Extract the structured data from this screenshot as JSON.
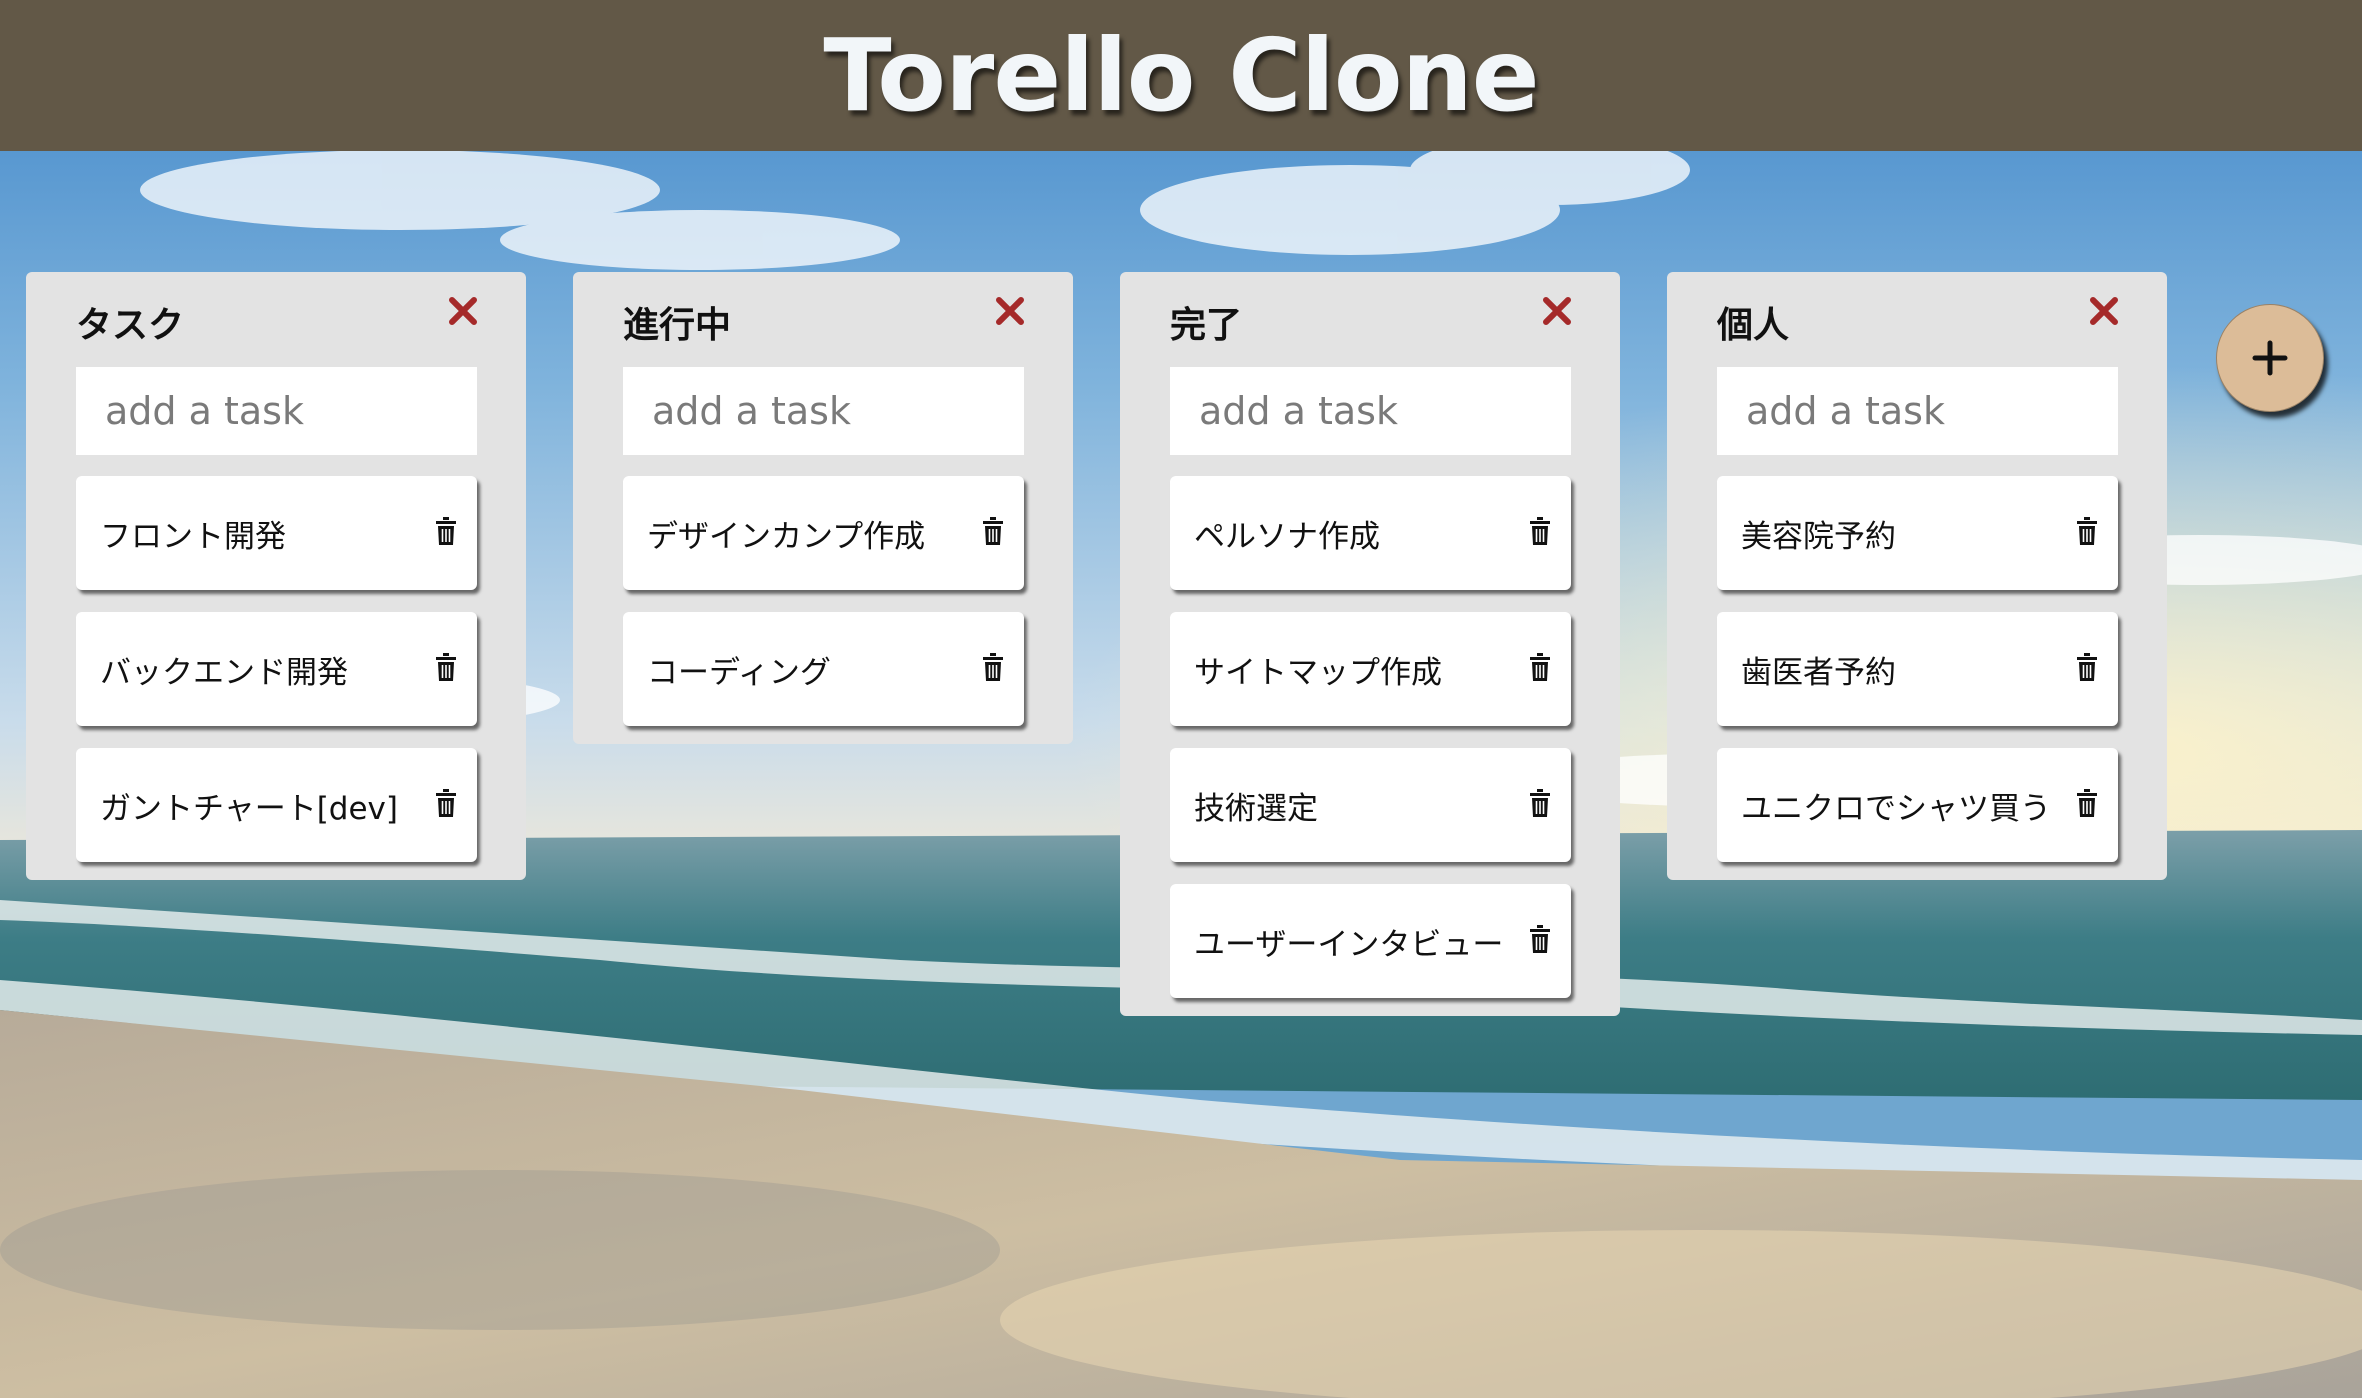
{
  "header": {
    "title": "Torello Clone"
  },
  "add_placeholder": "add a task",
  "add_list_label": "+",
  "colors": {
    "header_bg": "#625847",
    "list_bg": "#e3e3e3",
    "close_icon": "#a52a2a",
    "add_button_bg": "#dcbc98"
  },
  "icons": {
    "close": "close-icon",
    "delete": "trash-icon",
    "add": "plus-icon"
  },
  "lists": [
    {
      "title": "タスク",
      "cards": [
        "フロント開発",
        "バックエンド開発",
        "ガントチャート[dev]"
      ]
    },
    {
      "title": "進行中",
      "cards": [
        "デザインカンプ作成",
        "コーディング"
      ]
    },
    {
      "title": "完了",
      "cards": [
        "ペルソナ作成",
        "サイトマップ作成",
        "技術選定",
        "ユーザーインタビュー"
      ]
    },
    {
      "title": "個人",
      "cards": [
        "美容院予約",
        "歯医者予約",
        "ユニクロでシャツ買う"
      ]
    }
  ]
}
